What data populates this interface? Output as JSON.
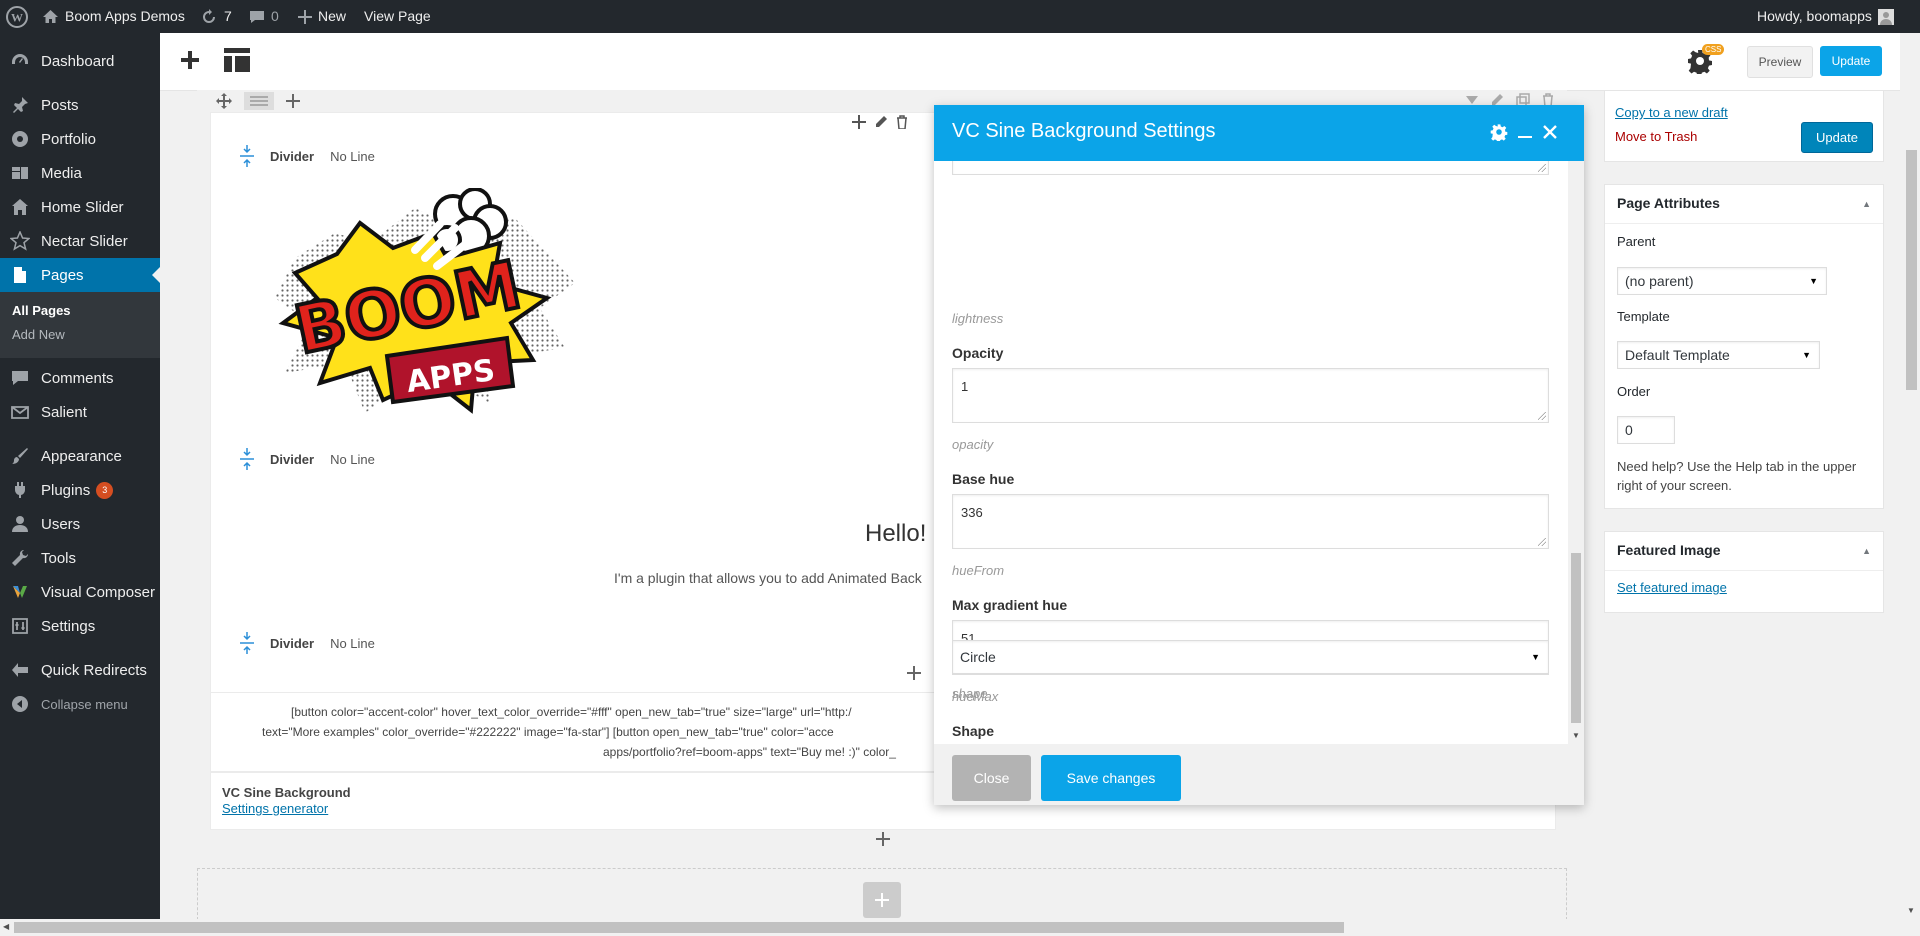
{
  "adminbar": {
    "site_name": "Boom Apps Demos",
    "updates_count": "7",
    "comments_count": "0",
    "new_label": "New",
    "view_page_label": "View Page",
    "howdy": "Howdy, boomapps"
  },
  "sidebar": {
    "items": [
      {
        "label": "Dashboard",
        "icon": "dashboard-icon"
      },
      {
        "label": "Posts",
        "icon": "pin-icon"
      },
      {
        "label": "Portfolio",
        "icon": "portfolio-icon"
      },
      {
        "label": "Media",
        "icon": "media-icon"
      },
      {
        "label": "Home Slider",
        "icon": "home-icon"
      },
      {
        "label": "Nectar Slider",
        "icon": "star-icon"
      },
      {
        "label": "Pages",
        "icon": "pages-icon"
      },
      {
        "label": "Comments",
        "icon": "comment-icon"
      },
      {
        "label": "Salient",
        "icon": "envelope-icon"
      },
      {
        "label": "Appearance",
        "icon": "brush-icon"
      },
      {
        "label": "Plugins",
        "icon": "plugin-icon",
        "badge": "3"
      },
      {
        "label": "Users",
        "icon": "user-icon"
      },
      {
        "label": "Tools",
        "icon": "wrench-icon"
      },
      {
        "label": "Visual Composer",
        "icon": "vc-icon"
      },
      {
        "label": "Settings",
        "icon": "settings-icon"
      },
      {
        "label": "Quick Redirects",
        "icon": "redirect-icon"
      }
    ],
    "submenu": [
      "All Pages",
      "Add New"
    ],
    "collapse_label": "Collapse menu"
  },
  "toolbar": {
    "css_badge": "CSS",
    "preview_label": "Preview",
    "update_label": "Update"
  },
  "canvas": {
    "divider_label": "Divider",
    "divider_value": "No Line",
    "logo_text_top": "BOOM",
    "logo_text_bottom": "APPS",
    "hello_text": "Hello!",
    "intro_text": "I'm a plugin that allows you to add Animated Back",
    "shortcode_line1": "[button color=\"accent-color\" hover_text_color_override=\"#fff\" open_new_tab=\"true\" size=\"large\" url=\"http:/",
    "shortcode_line2": "text=\"More examples\" color_override=\"#222222\" image=\"fa-star\"]      [button open_new_tab=\"true\" color=\"acce",
    "shortcode_line3": "apps/portfolio?ref=boom-apps\" text=\"Buy me! :)\" color_",
    "element_title": "VC Sine Background",
    "element_link": "Settings generator"
  },
  "publish": {
    "copy_draft": "Copy to a new draft",
    "trash": "Move to Trash",
    "update_label": "Update"
  },
  "page_attributes": {
    "title": "Page Attributes",
    "parent_label": "Parent",
    "parent_value": "(no parent)",
    "template_label": "Template",
    "template_value": "Default Template",
    "order_label": "Order",
    "order_value": "0",
    "help_line1": "Need help? Use the Help tab in the upper",
    "help_line2": "right of your screen."
  },
  "featured_image": {
    "title": "Featured Image",
    "link": "Set featured image"
  },
  "modal": {
    "title": "VC Sine Background Settings",
    "fields": [
      {
        "help": "lightness"
      },
      {
        "label": "Opacity",
        "value": "1",
        "help": "opacity"
      },
      {
        "label": "Base hue",
        "value": "336",
        "help": "hueFrom"
      },
      {
        "label": "Max gradient hue",
        "value": "51",
        "help": "hueMax"
      },
      {
        "label": "Shape",
        "value": "Circle",
        "help": "shape"
      }
    ],
    "close_label": "Close",
    "save_label": "Save changes"
  },
  "colors": {
    "admin_bg": "#23282d",
    "wp_blue": "#0073aa",
    "modal_header": "#0ba4e8",
    "button_blue": "#0ba4e8",
    "trash_red": "#a00"
  }
}
